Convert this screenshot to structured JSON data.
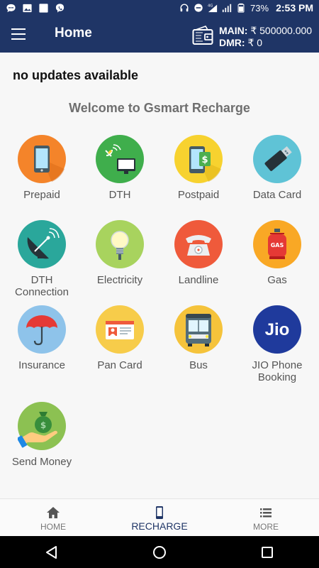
{
  "status_bar": {
    "battery": "73%",
    "time": "2:53 PM",
    "network": "4G"
  },
  "header": {
    "title": "Home",
    "main_label": "MAIN:",
    "main_value": "₹ 500000.000",
    "dmr_label": "DMR:",
    "dmr_value": "₹ 0"
  },
  "main": {
    "updates_text": "no updates available",
    "welcome_text": "Welcome to Gsmart Recharge",
    "services": [
      {
        "label": "Prepaid",
        "icon": "prepaid-phone-icon"
      },
      {
        "label": "DTH",
        "icon": "dth-tv-icon"
      },
      {
        "label": "Postpaid",
        "icon": "postpaid-phone-icon"
      },
      {
        "label": "Data Card",
        "icon": "usb-data-card-icon"
      },
      {
        "label": "DTH\nConnection",
        "icon": "satellite-dish-icon"
      },
      {
        "label": "Electricity",
        "icon": "light-bulb-icon"
      },
      {
        "label": "Landline",
        "icon": "telephone-icon"
      },
      {
        "label": "Gas",
        "icon": "gas-cylinder-icon"
      },
      {
        "label": "Insurance",
        "icon": "umbrella-icon"
      },
      {
        "label": "Pan Card",
        "icon": "id-card-icon"
      },
      {
        "label": "Bus",
        "icon": "bus-icon"
      },
      {
        "label": "JIO Phone\nBooking",
        "icon": "jio-logo-icon",
        "logo_text": "Jio"
      },
      {
        "label": "Send Money",
        "icon": "money-bag-hand-icon"
      }
    ]
  },
  "bottom_nav": {
    "items": [
      {
        "label": "HOME",
        "icon": "home-icon"
      },
      {
        "label": "RECHARGE",
        "icon": "mobile-icon"
      },
      {
        "label": "MORE",
        "icon": "list-icon"
      }
    ]
  },
  "colors": {
    "primary": "#1f3566",
    "prepaid": "#f4842a",
    "dth": "#3fae4c",
    "postpaid": "#f7d22f",
    "datacard": "#5fc3d6",
    "dth_connection": "#2aa79b",
    "electricity": "#a8d35e",
    "landline": "#ef5a3b",
    "gas": "#f9a825",
    "insurance": "#8ec3ea",
    "pancard": "#f7cc4a",
    "bus": "#f5c33b",
    "jio": "#1f3a9c",
    "send_money": "#8cc152"
  }
}
